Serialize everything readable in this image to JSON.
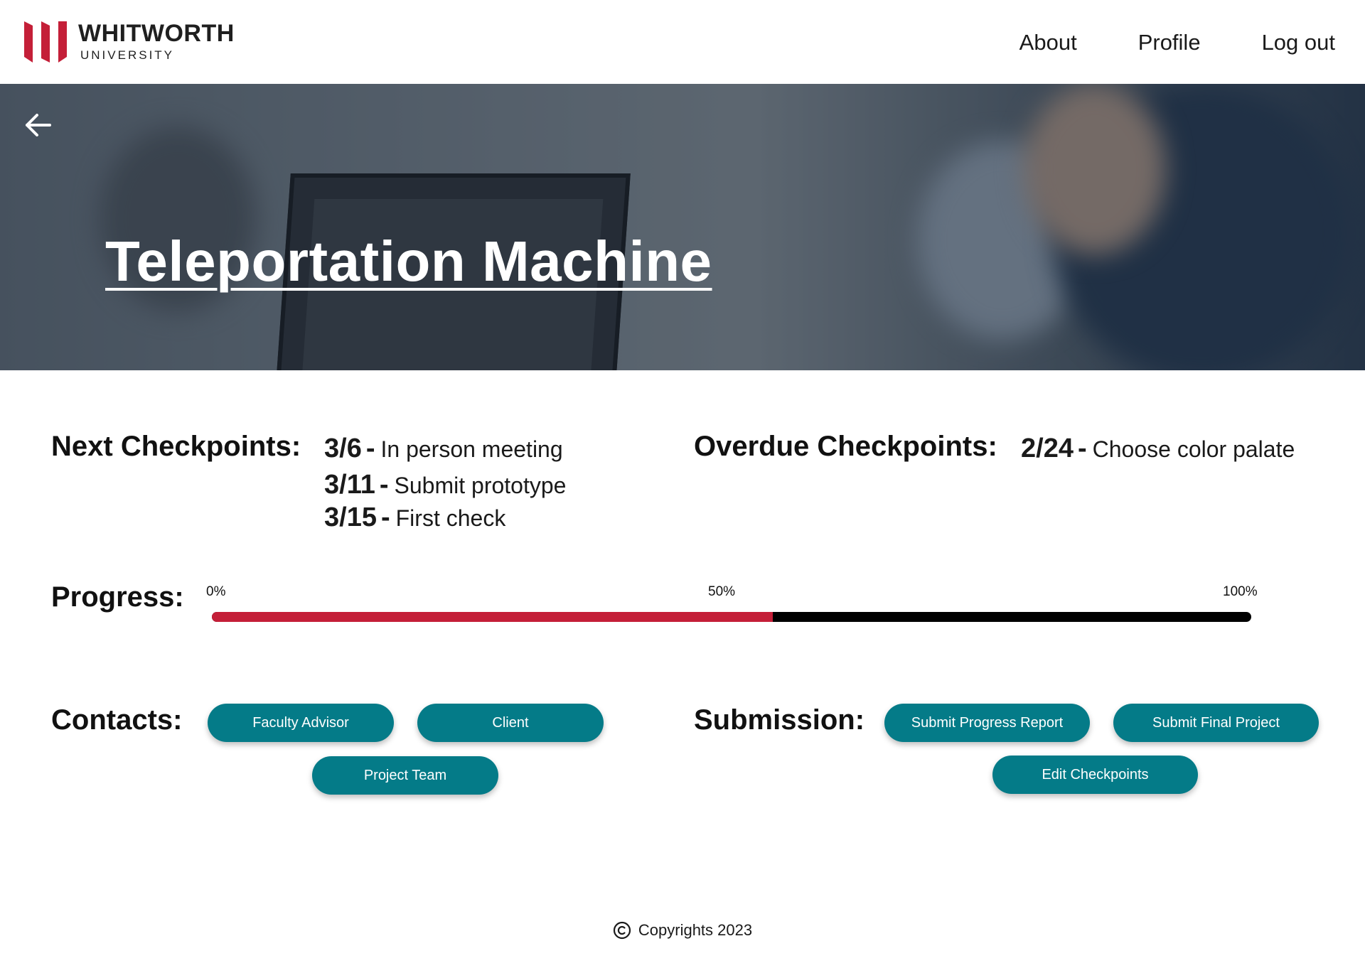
{
  "brand": {
    "name": "WHITWORTH",
    "sub": "UNIVERSITY",
    "color": "#c41f38"
  },
  "nav": {
    "about": "About",
    "profile": "Profile",
    "logout": "Log out"
  },
  "hero": {
    "title": "Teleportation Machine"
  },
  "next_checkpoints": {
    "label": "Next Checkpoints:",
    "items": [
      {
        "date": "3/6",
        "text": "In person meeting"
      },
      {
        "date": "3/11",
        "text": "Submit prototype"
      },
      {
        "date": "3/15",
        "text": "First check"
      }
    ]
  },
  "overdue_checkpoints": {
    "label": "Overdue Checkpoints:",
    "items": [
      {
        "date": "2/24",
        "text": "Choose color palate"
      }
    ]
  },
  "progress": {
    "label": "Progress:",
    "tick_0": "0%",
    "tick_50": "50%",
    "tick_100": "100%",
    "value_percent": 54,
    "fill_color": "#c41f38",
    "track_color": "#000000"
  },
  "contacts": {
    "label": "Contacts:",
    "faculty_advisor": "Faculty Advisor",
    "client": "Client",
    "project_team": "Project Team"
  },
  "submission": {
    "label": "Submission:",
    "progress_report": "Submit Progress Report",
    "final_project": "Submit Final Project",
    "edit_checkpoints": "Edit Checkpoints"
  },
  "footer": {
    "text": "Copyrights 2023"
  },
  "icons": {
    "back": "arrow-left-icon",
    "copyright": "copyright-icon"
  }
}
